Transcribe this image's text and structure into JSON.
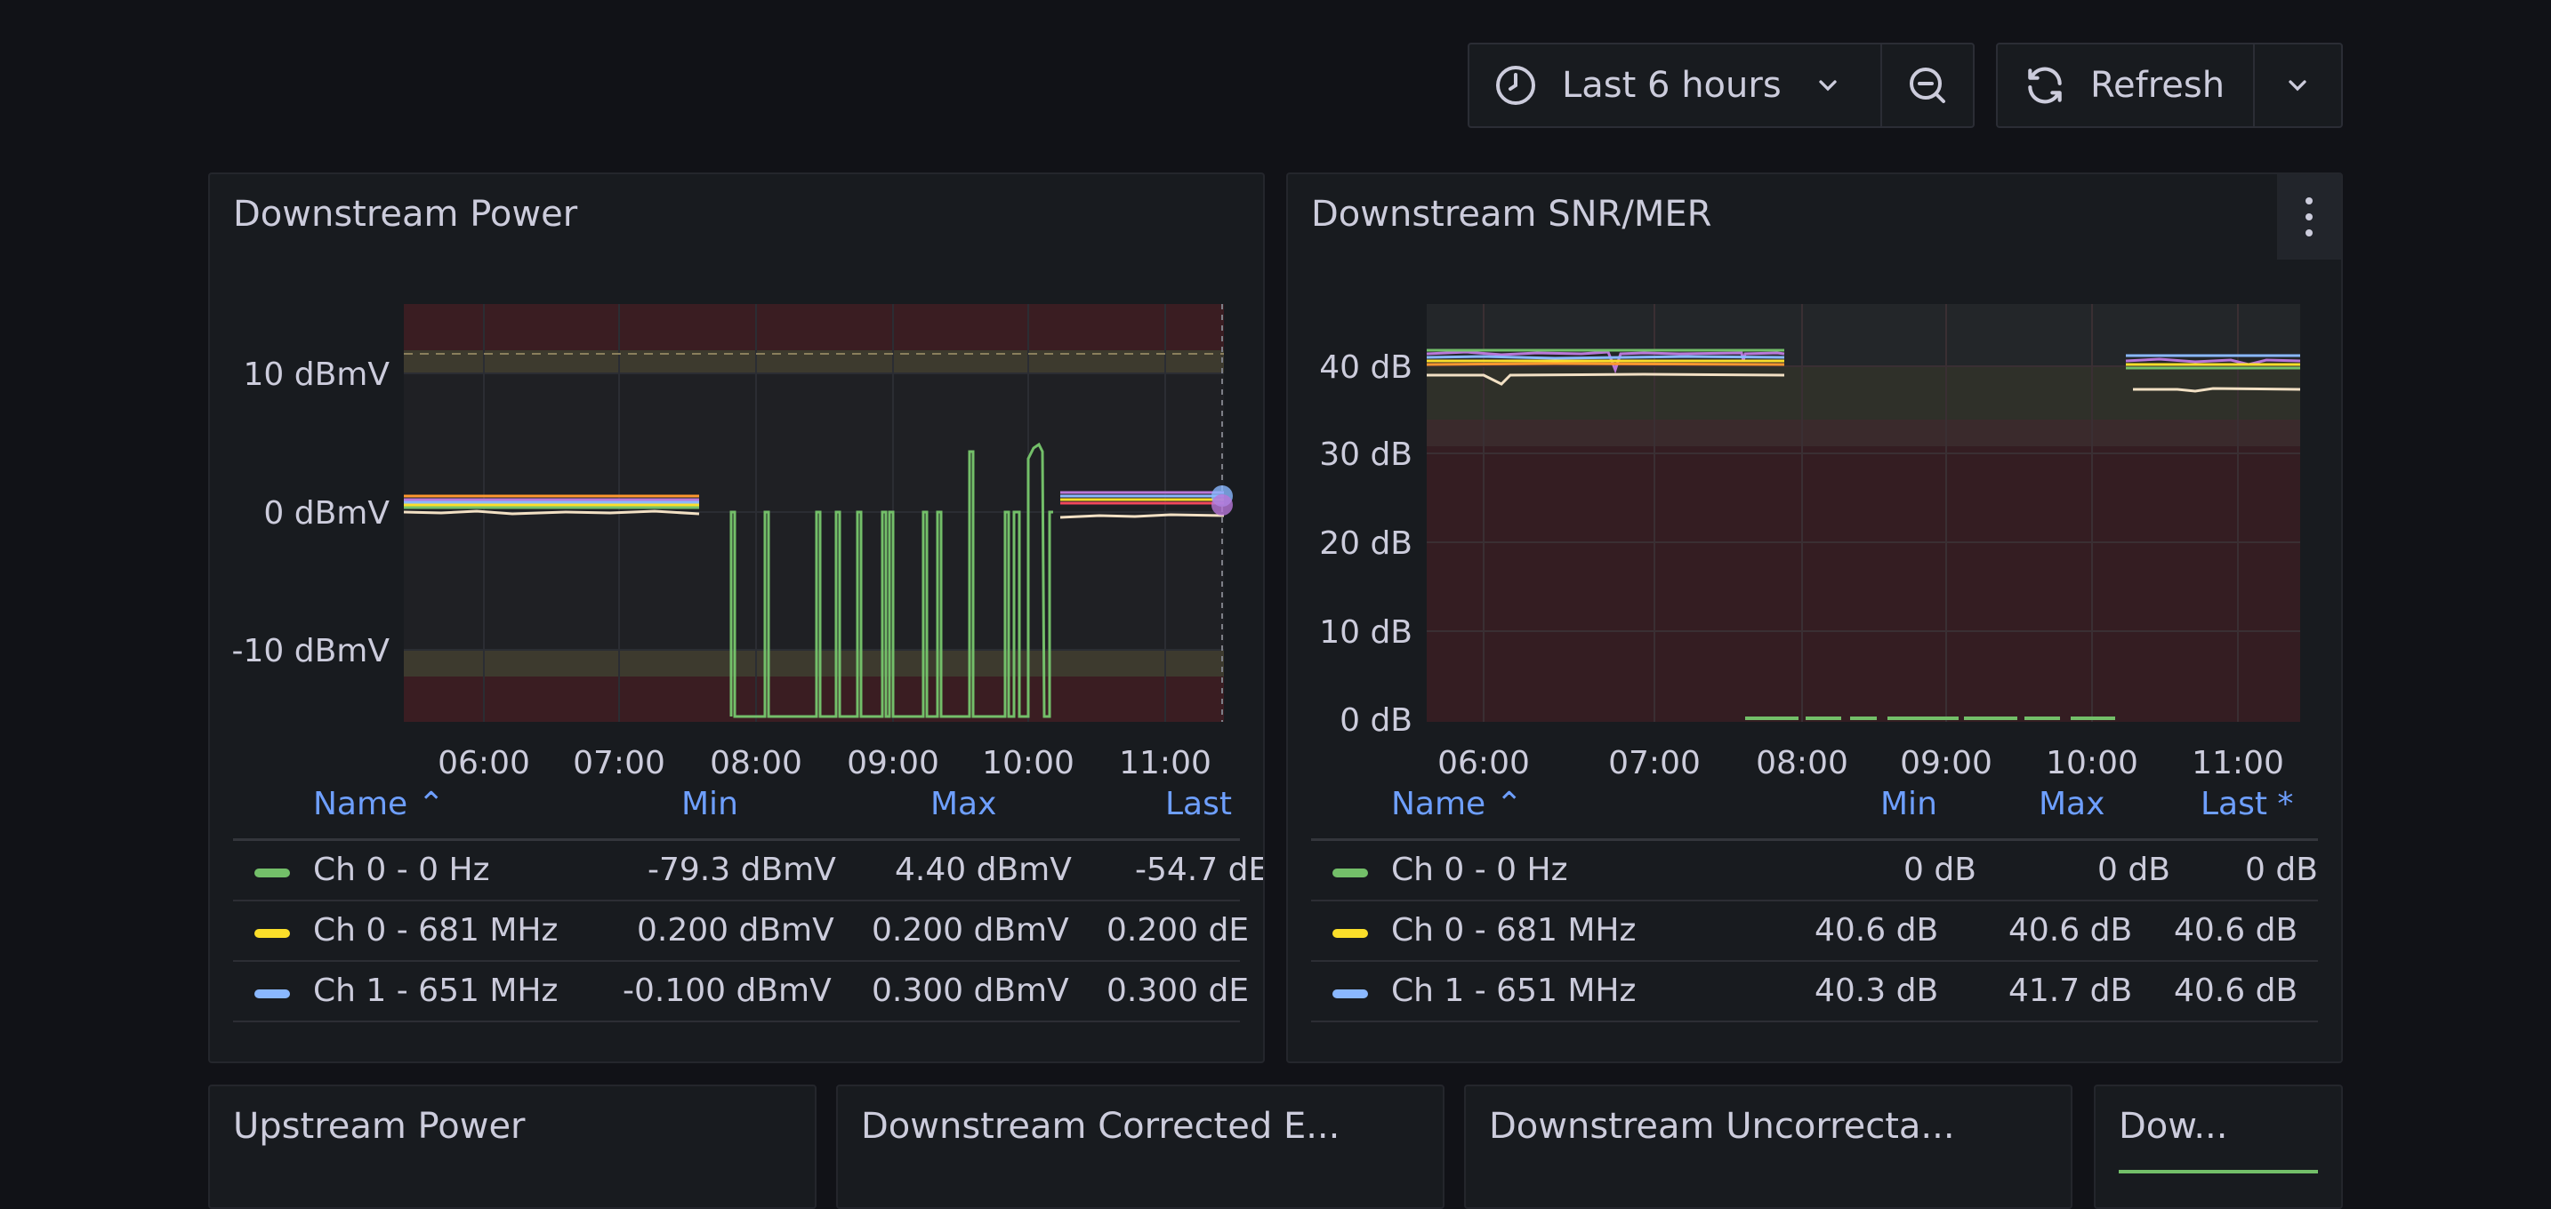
{
  "toolbar": {
    "time_range_label": "Last 6 hours",
    "refresh_label": "Refresh"
  },
  "colors": {
    "background": "#111217",
    "panel": "#181b1f",
    "link_blue": "#6e9fff",
    "series_green": "#73bf69",
    "series_yellow": "#fade2a",
    "series_blue": "#8ab8ff",
    "threshold_red": "#3a1d22",
    "threshold_olive": "#3d3a2e"
  },
  "panels": {
    "downstream_power": {
      "title": "Downstream Power",
      "legend": {
        "headers": {
          "name": "Name ⌃",
          "min": "Min",
          "max": "Max",
          "last": "Last"
        },
        "rows": [
          {
            "name": "Ch 0 - 0 Hz",
            "min": "-79.3 dBmV",
            "max": "4.40 dBmV",
            "last": "-54.7 dE",
            "color": "#73bf69"
          },
          {
            "name": "Ch 0 - 681 MHz",
            "min": "0.200 dBmV",
            "max": "0.200 dBmV",
            "last": "0.200 dE",
            "color": "#fade2a"
          },
          {
            "name": "Ch 1 - 651 MHz",
            "min": "-0.100 dBmV",
            "max": "0.300 dBmV",
            "last": "0.300 dE",
            "color": "#8ab8ff"
          }
        ]
      }
    },
    "downstream_snr": {
      "title": "Downstream SNR/MER",
      "legend": {
        "headers": {
          "name": "Name ⌃",
          "min": "Min",
          "max": "Max",
          "last": "Last *"
        },
        "rows": [
          {
            "name": "Ch 0 - 0 Hz",
            "min": "0 dB",
            "max": "0 dB",
            "last": "0 dB",
            "color": "#73bf69"
          },
          {
            "name": "Ch 0 - 681 MHz",
            "min": "40.6 dB",
            "max": "40.6 dB",
            "last": "40.6 dB",
            "color": "#fade2a"
          },
          {
            "name": "Ch 1 - 651 MHz",
            "min": "40.3 dB",
            "max": "41.7 dB",
            "last": "40.6 dB",
            "color": "#8ab8ff"
          }
        ]
      }
    },
    "bottom_titles": [
      "Upstream Power",
      "Downstream Corrected E...",
      "Downstream Uncorrecta...",
      "Dow..."
    ]
  },
  "chart_data": [
    {
      "type": "line",
      "title": "Downstream Power",
      "x_ticks": [
        "06:00",
        "07:00",
        "08:00",
        "09:00",
        "10:00",
        "11:00"
      ],
      "y_ticks": [
        "10 dBmV",
        "0 dBmV",
        "-10 dBmV"
      ],
      "ylim": [
        -15,
        15
      ],
      "thresholds": [
        {
          "from": -15,
          "to": -12,
          "color": "red"
        },
        {
          "from": -12,
          "to": -10,
          "color": "olive"
        },
        {
          "from": 10,
          "to": 12,
          "color": "olive"
        },
        {
          "from": 12,
          "to": 15,
          "color": "red"
        }
      ],
      "series": [
        {
          "name": "Ch 0 - 0 Hz",
          "color": "#73bf69",
          "note": "drops between 0 and -79.3 dBmV from 07:50 to 10:10"
        },
        {
          "name": "Ch 0 - 681 MHz",
          "color": "#fade2a",
          "level": 0.2
        },
        {
          "name": "Ch 1 - 651 MHz",
          "color": "#8ab8ff",
          "level": 0.3
        }
      ]
    },
    {
      "type": "line",
      "title": "Downstream SNR/MER",
      "x_ticks": [
        "06:00",
        "07:00",
        "08:00",
        "09:00",
        "10:00",
        "11:00"
      ],
      "y_ticks": [
        "40 dB",
        "30 dB",
        "20 dB",
        "10 dB",
        "0 dB"
      ],
      "ylim": [
        0,
        47
      ],
      "series": [
        {
          "name": "Ch 0 - 0 Hz",
          "color": "#73bf69",
          "level": 0
        },
        {
          "name": "Ch 0 - 681 MHz",
          "color": "#fade2a",
          "level": 40.6
        },
        {
          "name": "Ch 1 - 651 MHz",
          "color": "#8ab8ff",
          "level": 40.6
        }
      ]
    }
  ]
}
